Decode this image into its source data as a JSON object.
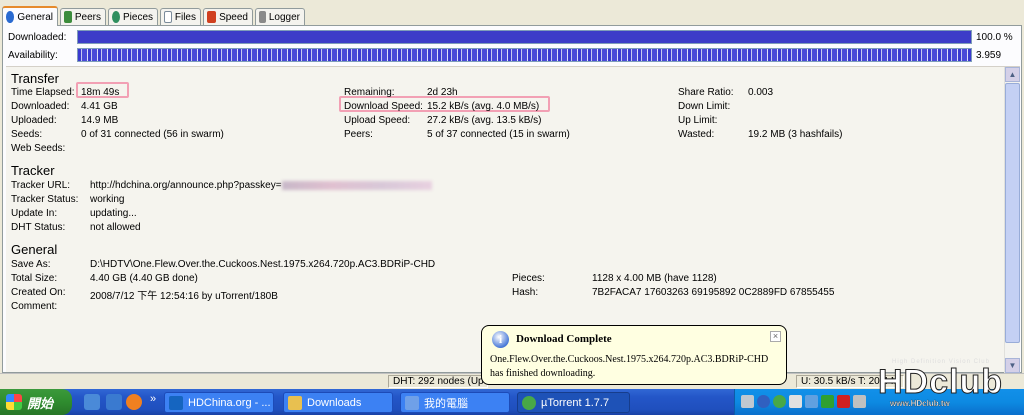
{
  "tabs": [
    {
      "label": "General",
      "icon": "info-icon",
      "color": "#2a6bd1"
    },
    {
      "label": "Peers",
      "icon": "peers-icon",
      "color": "#3c8c3c"
    },
    {
      "label": "Pieces",
      "icon": "pieces-icon",
      "color": "#2f8f5f"
    },
    {
      "label": "Files",
      "icon": "files-icon",
      "color": "#7a8a9a"
    },
    {
      "label": "Speed",
      "icon": "speed-icon",
      "color": "#d04020"
    },
    {
      "label": "Logger",
      "icon": "logger-icon",
      "color": "#8a8a8a"
    }
  ],
  "bars": {
    "downloaded_label": "Downloaded:",
    "downloaded_value": "100.0 %",
    "downloaded_fraction": 1.0,
    "availability_label": "Availability:",
    "availability_value": "3.959"
  },
  "transfer": {
    "title": "Transfer",
    "col1": [
      {
        "label": "Time Elapsed:",
        "value": "18m 49s"
      },
      {
        "label": "Downloaded:",
        "value": "4.41 GB"
      },
      {
        "label": "Uploaded:",
        "value": "14.9 MB"
      },
      {
        "label": "Seeds:",
        "value": "0 of 31 connected (56 in swarm)"
      },
      {
        "label": "Web Seeds:",
        "value": ""
      }
    ],
    "col2": [
      {
        "label": "Remaining:",
        "value": "2d 23h"
      },
      {
        "label": "Download Speed:",
        "value": "15.2 kB/s (avg. 4.0 MB/s)"
      },
      {
        "label": "Upload Speed:",
        "value": "27.2 kB/s (avg. 13.5 kB/s)"
      },
      {
        "label": "Peers:",
        "value": "5 of 37 connected (15 in swarm)"
      }
    ],
    "col3": [
      {
        "label": "Share Ratio:",
        "value": "0.003"
      },
      {
        "label": "Down Limit:",
        "value": ""
      },
      {
        "label": "Up Limit:",
        "value": ""
      },
      {
        "label": "Wasted:",
        "value": "19.2 MB (3 hashfails)"
      }
    ]
  },
  "tracker": {
    "title": "Tracker",
    "rows": [
      {
        "label": "Tracker URL:",
        "value": "http://hdchina.org/announce.php?passkey="
      },
      {
        "label": "Tracker Status:",
        "value": "working"
      },
      {
        "label": "Update In:",
        "value": "updating..."
      },
      {
        "label": "DHT Status:",
        "value": "not allowed"
      }
    ]
  },
  "general": {
    "title": "General",
    "col1": [
      {
        "label": "Save As:",
        "value": "D:\\HDTV\\One.Flew.Over.the.Cuckoos.Nest.1975.x264.720p.AC3.BDRiP-CHD"
      },
      {
        "label": "Total Size:",
        "value": "4.40 GB (4.40 GB done)"
      },
      {
        "label": "Created On:",
        "value": "2008/7/12 下午 12:54:16 by uTorrent/180B"
      },
      {
        "label": "Comment:",
        "value": ""
      }
    ],
    "col2": [
      {
        "label": "Pieces:",
        "value": "1128 x 4.00 MB (have 1128)"
      },
      {
        "label": "Hash:",
        "value": "7B2FACA7 17603263 69195892 0C2889FD 67855455"
      }
    ]
  },
  "statusbar": {
    "dht": "DHT: 292 nodes (Up",
    "upload": "U: 30.5 kB/s T: 20.4 M"
  },
  "balloon": {
    "title": "Download Complete",
    "line1": "One.Flew.Over.the.Cuckoos.Nest.1975.x264.720p.AC3.BDRiP-CHD",
    "line2": "has finished downloading.",
    "close": "×"
  },
  "taskbar": {
    "start_label": "開始",
    "tasks": [
      {
        "label": "HDChina.org - ...",
        "color": "#1565c0"
      },
      {
        "label": "Downloads",
        "color": "#e8c050"
      },
      {
        "label": "我的電腦",
        "color": "#6fa0e8"
      },
      {
        "label": "µTorrent 1.7.7",
        "color": "#48a848"
      }
    ],
    "quicklaunch_more": "»"
  },
  "watermark": {
    "big": "HDclub",
    "small": "www.HDclub.tw",
    "tag": "High Definition Vision Club"
  }
}
